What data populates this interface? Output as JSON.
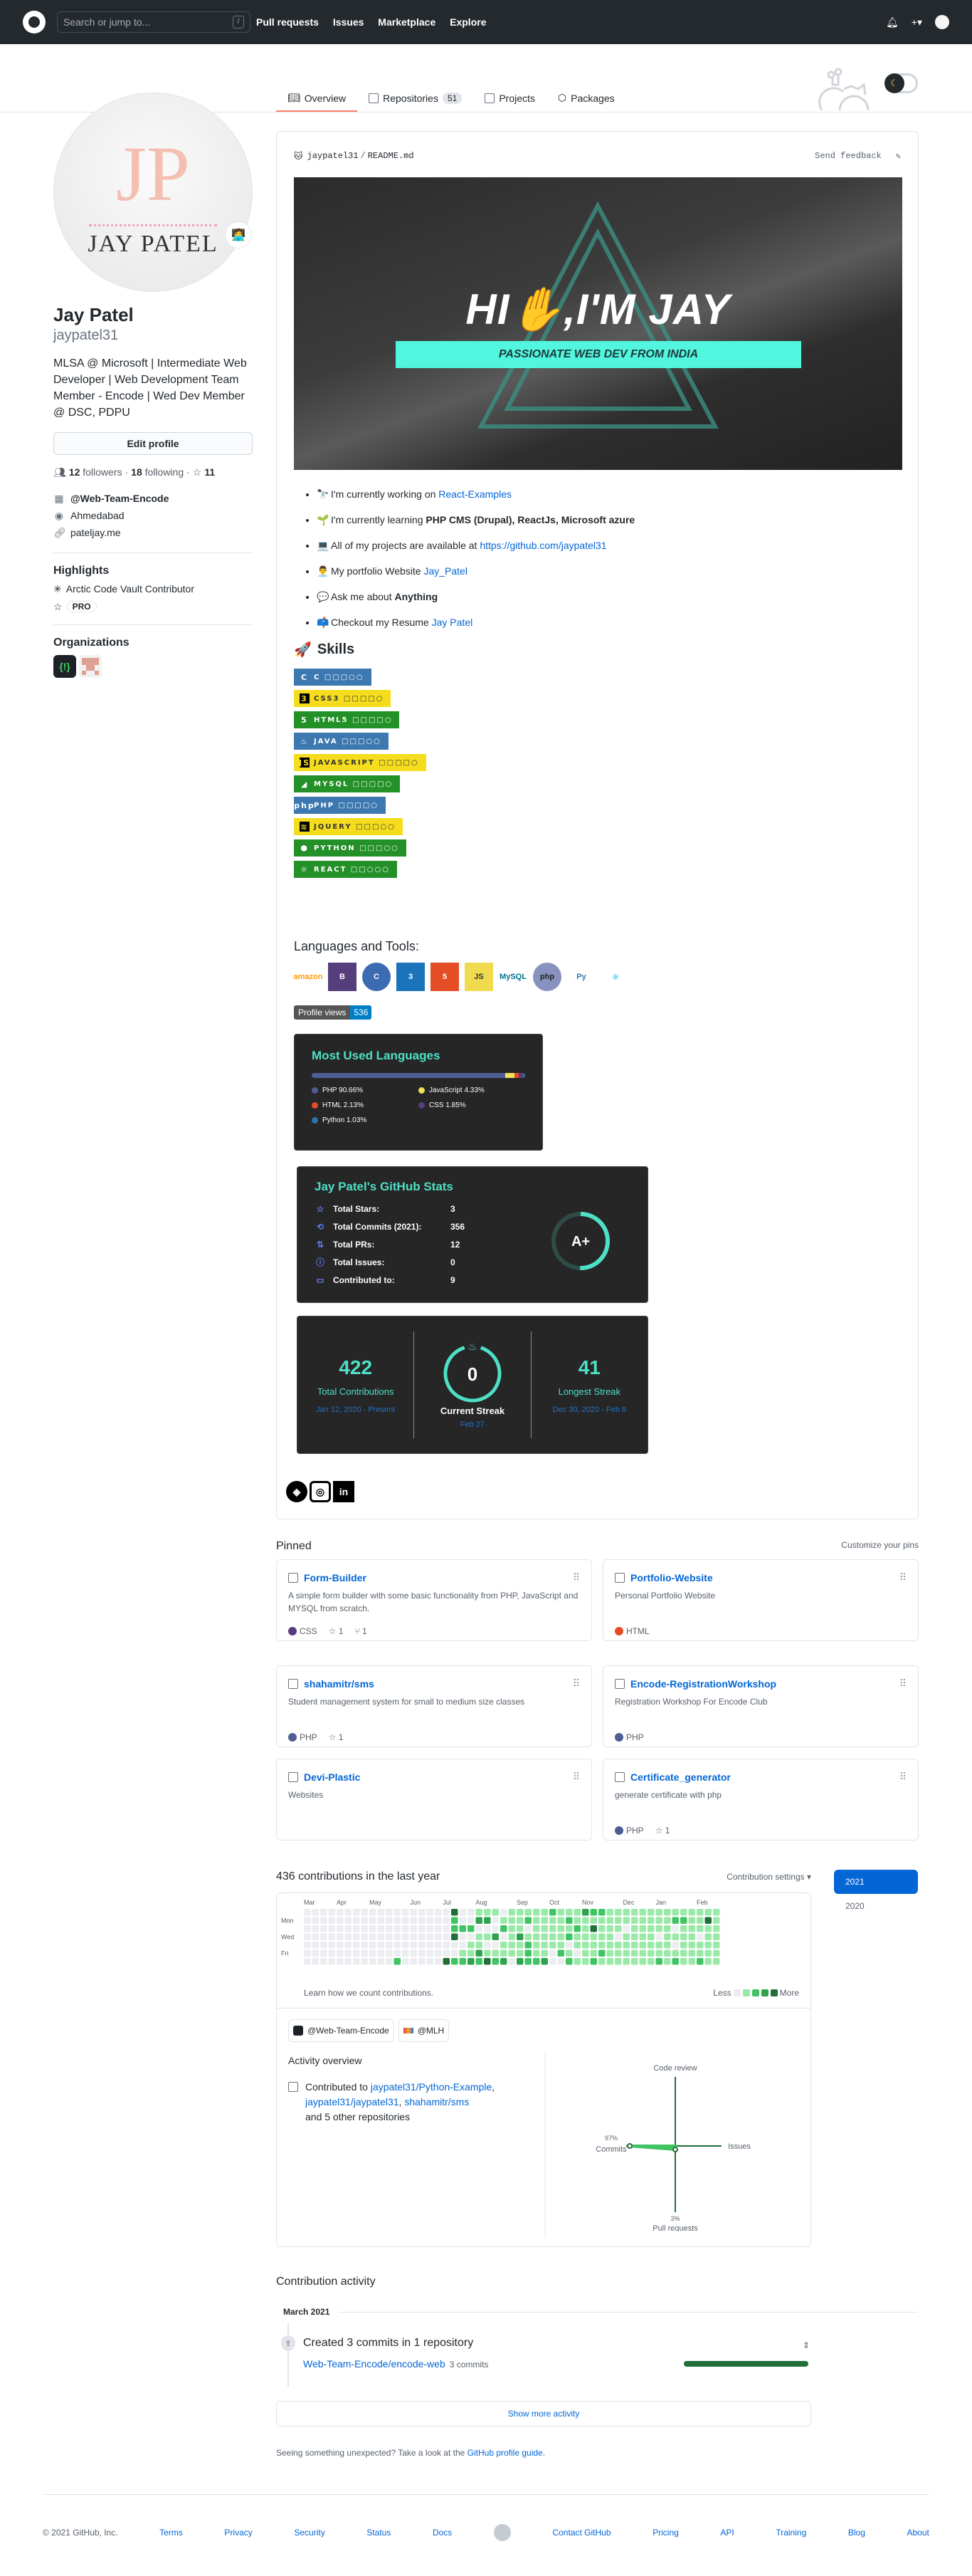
{
  "header": {
    "search_placeholder": "Search or jump to...",
    "search_shortcut": "/",
    "nav": [
      "Pull requests",
      "Issues",
      "Marketplace",
      "Explore"
    ],
    "plus": "+▾"
  },
  "tabs": [
    {
      "label": "Overview",
      "active": true
    },
    {
      "label": "Repositories",
      "count": "51"
    },
    {
      "label": "Projects"
    },
    {
      "label": "Packages"
    }
  ],
  "profile": {
    "avatar_initials": "JP",
    "avatar_name": "JAY PATEL",
    "status_emoji": "🧑‍💻",
    "name": "Jay Patel",
    "login": "jaypatel31",
    "bio": "MLSA @ Microsoft | Intermediate Web Developer | Web Development Team Member - Encode | Wed Dev Member @ DSC, PDPU",
    "edit_label": "Edit profile",
    "followers": "12",
    "followers_label": "followers",
    "following": "18",
    "following_label": "following",
    "stars": "11",
    "company": "@Web-Team-Encode",
    "location": "Ahmedabad",
    "website": "pateljay.me",
    "highlights_title": "Highlights",
    "highlight_arctic": "Arctic Code Vault Contributor",
    "highlight_pro": "PRO",
    "orgs_title": "Organizations",
    "org1_glyph": "{!}"
  },
  "readme": {
    "path_user": "jaypatel31",
    "path_sep": "/",
    "path_file": "README.md",
    "send_feedback": "Send feedback",
    "banner_title": "HI✋,I'M JAY",
    "banner_sub": "PASSIONATE WEB DEV FROM INDIA",
    "bullets": [
      {
        "emoji": "🔭",
        "text": "I'm currently working on ",
        "link": "React-Examples"
      },
      {
        "emoji": "🌱",
        "text": "I'm currently learning ",
        "bold": "PHP CMS (Drupal), ReactJs, Microsoft azure"
      },
      {
        "emoji": "💻",
        "text": "All of my projects are available at ",
        "link": "https://github.com/jaypatel31"
      },
      {
        "emoji": "👨‍💼",
        "text": "My portfolio Website ",
        "link": "Jay_Patel"
      },
      {
        "emoji": "💬",
        "text": "Ask me about ",
        "bold": "Anything"
      },
      {
        "emoji": "📫",
        "text": "Checkout my Resume ",
        "link": "Jay Patel"
      }
    ],
    "skills_title": "Skills",
    "skills": [
      {
        "icon": "C",
        "label": "C □□□○○",
        "color": "blue"
      },
      {
        "icon": "3",
        "label": "CSS3 □□□□○",
        "color": "yellow"
      },
      {
        "icon": "5",
        "label": "HTML5 □□□□○",
        "color": "green"
      },
      {
        "icon": "♨",
        "label": "JAVA □□□○○",
        "color": "blue"
      },
      {
        "icon": "JS",
        "label": "JAVASCRIPT □□□□○",
        "color": "yellow"
      },
      {
        "icon": "◢",
        "label": "MYSQL □□□□○",
        "color": "green"
      },
      {
        "icon": "php",
        "label": "PHP □□□□○",
        "color": "blue"
      },
      {
        "icon": "≋",
        "label": "JQUERY □□□○○",
        "color": "yellow"
      },
      {
        "icon": "⬢",
        "label": "PYTHON □□□○○",
        "color": "green"
      },
      {
        "icon": "⚛",
        "label": "REACT □□○○○",
        "color": "green"
      }
    ],
    "tools_title": "Languages and Tools:",
    "tools": [
      "aws",
      "bootstrap",
      "c",
      "css3",
      "html5",
      "javascript",
      "mysql",
      "php",
      "python",
      "react"
    ],
    "tool_labels": [
      "amazon",
      "B",
      "C",
      "3",
      "5",
      "JS",
      "MySQL",
      "php",
      "Py",
      "⚛"
    ],
    "profile_views_label": "Profile views",
    "profile_views": "536",
    "most_used_title": "Most Used Languages",
    "languages": [
      {
        "name": "PHP",
        "pct": 90.66,
        "label": "PHP 90.66%",
        "color": "#4F5D95"
      },
      {
        "name": "JavaScript",
        "pct": 4.33,
        "label": "JavaScript 4.33%",
        "color": "#f1e05a"
      },
      {
        "name": "HTML",
        "pct": 2.13,
        "label": "HTML 2.13%",
        "color": "#e34c26"
      },
      {
        "name": "CSS",
        "pct": 1.85,
        "label": "CSS 1.85%",
        "color": "#563d7c"
      },
      {
        "name": "Python",
        "pct": 1.03,
        "label": "Python 1.03%",
        "color": "#3572A5"
      }
    ],
    "stats_title": "Jay Patel's GitHub Stats",
    "stats": [
      {
        "icon": "☆",
        "label": "Total Stars:",
        "value": "3"
      },
      {
        "icon": "⟲",
        "label": "Total Commits (2021):",
        "value": "356"
      },
      {
        "icon": "⇅",
        "label": "Total PRs:",
        "value": "12"
      },
      {
        "icon": "ⓘ",
        "label": "Total Issues:",
        "value": "0"
      },
      {
        "icon": "▭",
        "label": "Contributed to:",
        "value": "9"
      }
    ],
    "grade": "A+",
    "streak": {
      "total": "422",
      "total_label": "Total Contributions",
      "total_range": "Jan 12, 2020 - Present",
      "current": "0",
      "current_label": "Current Streak",
      "current_date": "Feb 27",
      "longest": "41",
      "longest_label": "Longest Streak",
      "longest_range": "Dec 30, 2020 - Feb 8"
    },
    "social": [
      "◈",
      "◎",
      "in"
    ]
  },
  "pinned": {
    "title": "Pinned",
    "customize": "Customize your pins",
    "items": [
      {
        "name": "Form-Builder",
        "desc": "A simple form builder with some basic functionality from PHP, JavaScript and MYSQL from scratch.",
        "lang": "CSS",
        "lang_color": "#563d7c",
        "stars": "1",
        "forks": "1"
      },
      {
        "name": "Portfolio-Website",
        "desc": "Personal Portfolio Website",
        "lang": "HTML",
        "lang_color": "#e34c26"
      },
      {
        "name": "shahamitr/sms",
        "desc": "Student management system for small to medium size classes",
        "lang": "PHP",
        "lang_color": "#4F5D95",
        "stars": "1"
      },
      {
        "name": "Encode-RegistrationWorkshop",
        "desc": "Registration Workshop For Encode Club",
        "lang": "PHP",
        "lang_color": "#4F5D95"
      },
      {
        "name": "Devi-Plastic",
        "desc": "Websites"
      },
      {
        "name": "Certificate_generator",
        "desc": "generate certificate with php",
        "lang": "PHP",
        "lang_color": "#4F5D95",
        "stars": "1"
      }
    ]
  },
  "contributions": {
    "title": "436 contributions in the last year",
    "settings": "Contribution settings ▾",
    "years": [
      "2021",
      "2020"
    ],
    "months": [
      "Mar",
      "Apr",
      "May",
      "Jun",
      "Jul",
      "Aug",
      "Sep",
      "Oct",
      "Nov",
      "Dec",
      "Jan",
      "Feb"
    ],
    "days": [
      "Mon",
      "Wed",
      "Fri"
    ],
    "learn": "Learn how we count contributions.",
    "less": "Less",
    "more": "More",
    "level_colors": [
      "#ebedf0",
      "#9be9a8",
      "#40c463",
      "#30a14e",
      "#216e39"
    ],
    "weeks": [
      "0000000",
      "0000000",
      "0000000",
      "0000000",
      "0000000",
      "0000000",
      "0000000",
      "0000000",
      "0000000",
      "0000000",
      "0000000",
      "0000002",
      "0000000",
      "0000000",
      "0000000",
      "0000000",
      "0000000",
      "0000004",
      "4224002",
      "0020012",
      "0020113",
      "1301132",
      "1301014",
      "1003012",
      "0120113",
      "1111110",
      "1113113",
      "1201222",
      "1111112",
      "1111113",
      "2111100",
      "1111120",
      "1212012",
      "1121101",
      "3111111",
      "2141112",
      "2111121",
      "1111111",
      "1110111",
      "1101111",
      "1111111",
      "1111111",
      "1111111",
      "1110112",
      "1111111",
      "1201012",
      "1211111",
      "1111111",
      "1110112",
      "1411111",
      "1111111"
    ],
    "orgs": [
      "@Web-Team-Encode",
      "@MLH"
    ],
    "activity_title": "Activity overview",
    "contributed_prefix": "Contributed to ",
    "contributed_links": [
      "jaypatel31/Python-Example",
      "jaypatel31/jaypatel31",
      "shahamitr/sms"
    ],
    "contributed_suffix": "and 5 other repositories",
    "radar": {
      "code_review": "Code review",
      "issues": "Issues",
      "commits": "Commits",
      "commits_pct": "97%",
      "prs": "Pull requests",
      "prs_pct": "3%"
    }
  },
  "activity": {
    "title": "Contribution activity",
    "month": "March 2021",
    "event": "Created 3 commits in 1 repository",
    "repo": "Web-Team-Encode/encode-web",
    "repo_commits": "3 commits",
    "show_more": "Show more activity",
    "unexpected_prefix": "Seeing something unexpected? Take a look at the ",
    "unexpected_link": "GitHub profile guide."
  },
  "footer": {
    "copyright": "© 2021 GitHub, Inc.",
    "left": [
      "Terms",
      "Privacy",
      "Security",
      "Status",
      "Docs"
    ],
    "right": [
      "Contact GitHub",
      "Pricing",
      "API",
      "Training",
      "Blog",
      "About"
    ]
  }
}
